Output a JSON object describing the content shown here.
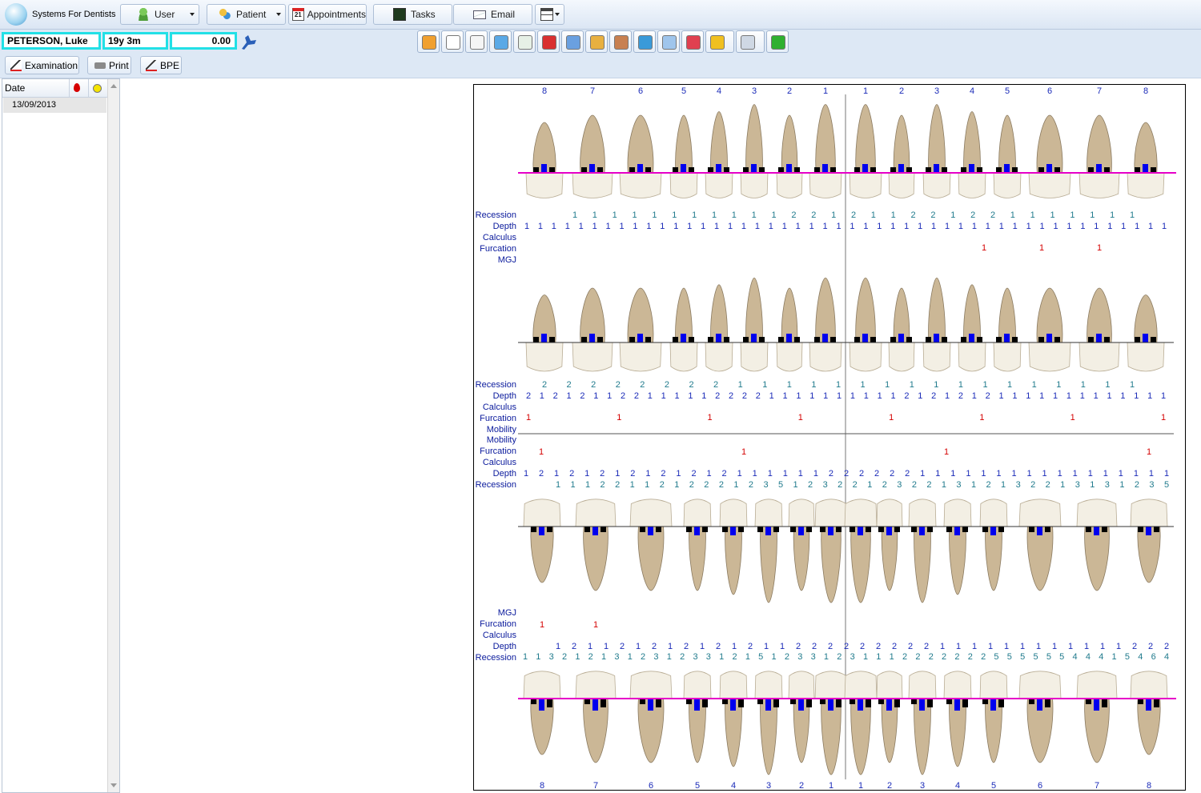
{
  "toolbar": {
    "app_title": "Systems For Dentists",
    "user_label": "User",
    "patient_label": "Patient",
    "appointments_label": "Appointments",
    "tasks_label": "Tasks",
    "email_label": "Email",
    "calendar_day": "21"
  },
  "patient": {
    "name": "PETERSON, Luke",
    "age": "19y 3m",
    "balance": "0.00"
  },
  "actions": {
    "examination_label": "Examination",
    "print_label": "Print",
    "bpe_label": "BPE"
  },
  "toolbar_icons": [
    "home-icon",
    "calendar-icon",
    "examination-icon",
    "tooth-treatment-icon",
    "document-icon",
    "medical-kit-icon",
    "paperclip-icon",
    "scales-icon",
    "xray-image-icon",
    "stack-icon",
    "card-icon",
    "lips-icon",
    "pen-icon",
    "layout-icon",
    "add-calendar-icon"
  ],
  "history": {
    "col_date": "Date",
    "rows": [
      "13/09/2013"
    ]
  },
  "perio": {
    "colors": {
      "label": "#0a1a9c",
      "depth": "#1a2ab8",
      "recession": "#1f7a8c",
      "furcation": "#d40000",
      "gumline": "#e600c8",
      "bar_blue": "#0000ee",
      "bar_black": "#000000"
    },
    "upper_numbers": [
      "8",
      "7",
      "6",
      "5",
      "4",
      "3",
      "2",
      "1",
      "1",
      "2",
      "3",
      "4",
      "5",
      "6",
      "7",
      "8"
    ],
    "lower_numbers": [
      "8",
      "7",
      "6",
      "5",
      "4",
      "3",
      "2",
      "1",
      "1",
      "2",
      "3",
      "4",
      "5",
      "6",
      "7",
      "8"
    ],
    "labels_upper_buccal": [
      "Recession",
      "Depth",
      "Calculus",
      "Furcation",
      "MGJ"
    ],
    "labels_upper_palatal": [
      "Recession",
      "Depth",
      "Calculus",
      "Furcation",
      "Mobility"
    ],
    "labels_lower_lingual": [
      "Mobility",
      "Furcation",
      "Calculus",
      "Depth",
      "Recession"
    ],
    "labels_lower_buccal": [
      "MGJ",
      "Furcation",
      "Calculus",
      "Depth",
      "Recession"
    ],
    "ub_recession": "1 1 1 1 1 1 1 1 1 1 1 2 2 1 2 1 1 2 2 1 2 2 1 1 1 1 1 1 1",
    "ub_depth": "1 1 1 1 1 1 1 1 1 1 1 1 1 1 1 1 1 1 1 1 1 1 1 1 1 1 1 1 1 1 1 1 1 1 1 1 1 1 1 1 1 1 1 1 1 1 1 1",
    "ub_furcation": "1 1 1",
    "up_recession": "2 2 2 2 2 2 2 2 1 1 1 1 1 1 1 1 1 1 1 1 1 1 1 1 1",
    "up_depth": "2 1 2 1 2 1 1 2 2 1 1 1 1 1 2 2 2 2 1 1 1 1 1 1 1 1 1 1 2 1 2 1 2 1 2 1 1 1 1 1 1 1 1 1 1 1 1 1",
    "up_furcation": "1 1 1 1 1 1 1 1",
    "ll_furcation": "1 1 1 1",
    "ll_depth": "1 2 1 2 1 2 1 2 1 2 1 2 1 2 1 1 1 1 1 1 2 2 2 2 2 2 1 1 1 1 1 1 1 1 1 1 1 1 1 1 1 1 1",
    "ll_recession": "1 1 1 2 2 1 1 2 1 2 2 2 1 2 3 5 1 2 3 2 2 1 2 3 2 2 1 3 1 2 1 3 2 2 1 3 1 3 1 2 3 5",
    "lb_furcation": "1 1",
    "lb_depth": "1 2 1 1 2 1 2 1 2 1 2 1 2 1 1 2 2 2 2 2 2 2 2 2 1 1 1 1 1 1 1 1 1 1 1 1 2 2 2",
    "lb_recession": "1 1 3 2 1 2 1 3 1 2 3 1 2 3 3 1 2 1 5 1 2 3 3 1 2 3 1 1 1 2 2 2 2 2 2 2 5 5 5 5 5 5 4 4 4 1 5 4 6 4"
  }
}
